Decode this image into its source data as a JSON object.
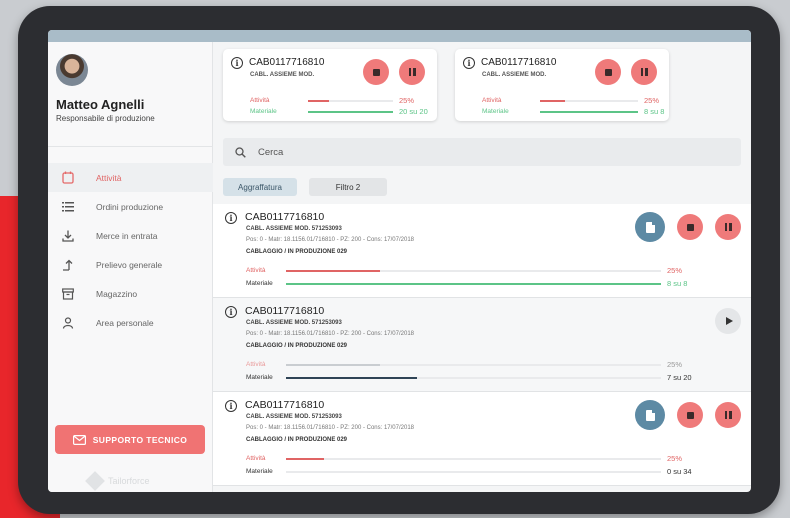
{
  "user": {
    "name": "Matteo Agnelli",
    "role": "Responsabile di produzione"
  },
  "nav": [
    {
      "label": "Attività",
      "icon": "calendar-icon",
      "active": true
    },
    {
      "label": "Ordini produzione",
      "icon": "list-icon",
      "active": false
    },
    {
      "label": "Merce in entrata",
      "icon": "download-icon",
      "active": false
    },
    {
      "label": "Prelievo generale",
      "icon": "arrow-up-icon",
      "active": false
    },
    {
      "label": "Magazzino",
      "icon": "archive-icon",
      "active": false
    },
    {
      "label": "Area personale",
      "icon": "person-icon",
      "active": false
    }
  ],
  "support_label": "SUPPORTO TECNICO",
  "brand": "Tailorforce",
  "top_cards": [
    {
      "code": "CAB0117716810",
      "subtitle": "CABL. ASSIEME MOD.",
      "activity": {
        "label": "Attività",
        "value_text": "25%",
        "progress": 0.25
      },
      "material": {
        "label": "Materiale",
        "value_text": "20 su 20",
        "progress": 1.0
      }
    },
    {
      "code": "CAB0117716810",
      "subtitle": "CABL. ASSIEME MOD.",
      "activity": {
        "label": "Attività",
        "value_text": "25%",
        "progress": 0.25
      },
      "material": {
        "label": "Materiale",
        "value_text": "8 su 8",
        "progress": 1.0
      }
    }
  ],
  "search": {
    "placeholder": "Cerca"
  },
  "filters": [
    "Aggraffatura",
    "Filtro 2"
  ],
  "tasks": [
    {
      "code": "CAB0117716810",
      "subtitle": "CABL. ASSIEME MOD. 571253093",
      "details": "Pos: 0 - Matr: 18.1156.01/716810 - PZ: 200 - Cons: 17/07/2018",
      "status": "CABLAGGIO / IN PRODUZIONE 029",
      "activity": {
        "label": "Attività",
        "value_text": "25%",
        "progress": 0.25
      },
      "material": {
        "label": "Materiale",
        "value_text": "8 su 8",
        "progress": 1.0
      },
      "buttons": [
        "document",
        "stop",
        "pause"
      ],
      "style": "active"
    },
    {
      "code": "CAB0117716810",
      "subtitle": "CABL. ASSIEME MOD. 571253093",
      "details": "Pos: 0 - Matr: 18.1156.01/716810 - PZ: 200 - Cons: 17/07/2018",
      "status": "CABLAGGIO / IN PRODUZIONE 029",
      "activity": {
        "label": "Attività",
        "value_text": "25%",
        "progress": 0.25
      },
      "material": {
        "label": "Materiale",
        "value_text": "7 su 20",
        "progress": 0.35
      },
      "buttons": [
        "play"
      ],
      "style": "idle"
    },
    {
      "code": "CAB0117716810",
      "subtitle": "CABL. ASSIEME MOD. 571253093",
      "details": "Pos: 0 - Matr: 18.1156.01/716810 - PZ: 200 - Cons: 17/07/2018",
      "status": "CABLAGGIO / IN PRODUZIONE 029",
      "activity": {
        "label": "Attività",
        "value_text": "25%",
        "progress": 0.1
      },
      "material": {
        "label": "Materiale",
        "value_text": "0 su 34",
        "progress": 0.0
      },
      "buttons": [
        "document",
        "stop",
        "pause"
      ],
      "style": "active"
    }
  ],
  "colors": {
    "accent_red": "#ef7a7a",
    "progress_red": "#e06464",
    "progress_green": "#5cc487",
    "progress_dark": "#2f4456",
    "doc_blue": "#5d8aa4"
  }
}
